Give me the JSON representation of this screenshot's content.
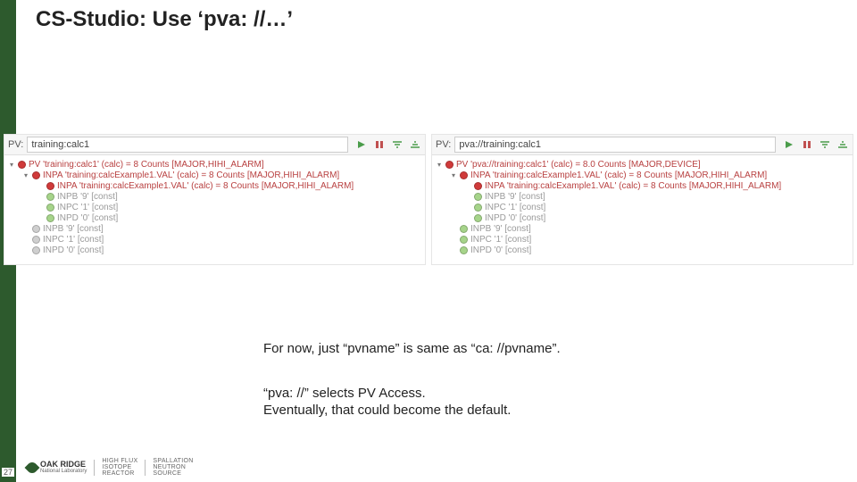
{
  "title": "CS-Studio: Use ‘pva: //…’",
  "pvLabel": "PV:",
  "left": {
    "pvValue": "training:calc1",
    "rows": [
      {
        "indent": 0,
        "caret": true,
        "color": "red",
        "alarm": true,
        "text": "PV 'training:calc1' (calc)  =  8 Counts [MAJOR,HIHI_ALARM]"
      },
      {
        "indent": 1,
        "caret": true,
        "color": "red",
        "alarm": true,
        "text": "INPA 'training:calcExample1.VAL' (calc)  =  8 Counts [MAJOR,HIHI_ALARM]"
      },
      {
        "indent": 2,
        "caret": false,
        "color": "red",
        "alarm": true,
        "text": "INPA 'training:calcExample1.VAL' (calc)  =  8 Counts [MAJOR,HIHI_ALARM]"
      },
      {
        "indent": 2,
        "caret": false,
        "color": "green",
        "alarm": false,
        "text": "INPB '9' [const]"
      },
      {
        "indent": 2,
        "caret": false,
        "color": "green",
        "alarm": false,
        "text": "INPC '1' [const]"
      },
      {
        "indent": 2,
        "caret": false,
        "color": "green",
        "alarm": false,
        "text": "INPD '0' [const]"
      },
      {
        "indent": 1,
        "caret": false,
        "color": "grey",
        "alarm": false,
        "text": "INPB '9' [const]"
      },
      {
        "indent": 1,
        "caret": false,
        "color": "grey",
        "alarm": false,
        "text": "INPC '1' [const]"
      },
      {
        "indent": 1,
        "caret": false,
        "color": "grey",
        "alarm": false,
        "text": "INPD '0' [const]"
      }
    ]
  },
  "right": {
    "pvValue": "pva://training:calc1",
    "rows": [
      {
        "indent": 0,
        "caret": true,
        "color": "red",
        "alarm": true,
        "text": "PV 'pva://training:calc1' (calc)  =  8.0 Counts [MAJOR,DEVICE]"
      },
      {
        "indent": 1,
        "caret": true,
        "color": "red",
        "alarm": true,
        "text": "INPA 'training:calcExample1.VAL' (calc)  =  8 Counts [MAJOR,HIHI_ALARM]"
      },
      {
        "indent": 2,
        "caret": false,
        "color": "red",
        "alarm": true,
        "text": "INPA 'training:calcExample1.VAL' (calc)  =  8 Counts [MAJOR,HIHI_ALARM]"
      },
      {
        "indent": 2,
        "caret": false,
        "color": "green",
        "alarm": false,
        "text": "INPB '9' [const]"
      },
      {
        "indent": 2,
        "caret": false,
        "color": "green",
        "alarm": false,
        "text": "INPC '1' [const]"
      },
      {
        "indent": 2,
        "caret": false,
        "color": "green",
        "alarm": false,
        "text": "INPD '0' [const]"
      },
      {
        "indent": 1,
        "caret": false,
        "color": "green",
        "alarm": false,
        "text": "INPB '9' [const]"
      },
      {
        "indent": 1,
        "caret": false,
        "color": "green",
        "alarm": false,
        "text": "INPC '1' [const]"
      },
      {
        "indent": 1,
        "caret": false,
        "color": "green",
        "alarm": false,
        "text": "INPD '0' [const]"
      }
    ]
  },
  "body1": "For now, just “pvname” is same as “ca: //pvname”.",
  "body2a": "“pva: //” selects PV Access.",
  "body2b": "Eventually, that could become the default.",
  "pageNumber": "27",
  "logo": {
    "oak1": "OAK RIDGE",
    "oak2": "National Laboratory",
    "hflux1": "HIGH FLUX",
    "hflux2": "ISOTOPE",
    "hflux3": "REACTOR",
    "sns1": "SPALLATION",
    "sns2": "NEUTRON",
    "sns3": "SOURCE"
  }
}
